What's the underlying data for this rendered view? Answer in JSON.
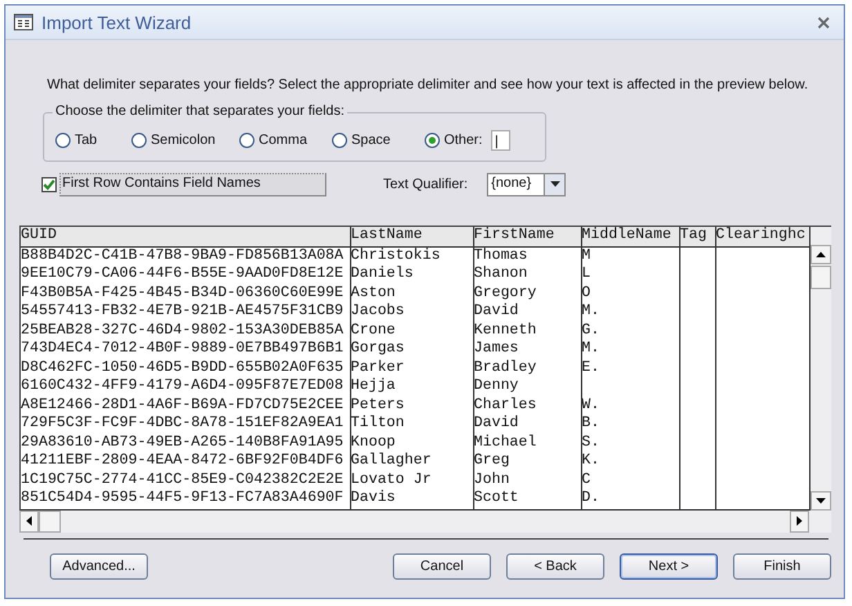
{
  "window": {
    "title": "Import Text Wizard"
  },
  "prompt": "What delimiter separates your fields? Select the appropriate delimiter and see how your text is affected in the preview below.",
  "delimiter_group": {
    "legend": "Choose the delimiter that separates your fields:",
    "options": [
      {
        "label": "Tab",
        "selected": false
      },
      {
        "label": "Semicolon",
        "selected": false
      },
      {
        "label": "Comma",
        "selected": false
      },
      {
        "label": "Space",
        "selected": false
      },
      {
        "label": "Other:",
        "selected": true
      }
    ],
    "other_value": "|"
  },
  "first_row_names": {
    "label": "First Row Contains Field Names",
    "checked": true
  },
  "text_qualifier": {
    "label": "Text Qualifier:",
    "value": "{none}"
  },
  "preview": {
    "columns": [
      "GUID",
      "LastName",
      "FirstName",
      "MiddleName",
      "Tag",
      "Clearinghc"
    ],
    "rows": [
      [
        "B88B4D2C-C41B-47B8-9BA9-FD856B13A08A",
        "Christokis",
        "Thomas",
        "M",
        "",
        ""
      ],
      [
        "9EE10C79-CA06-44F6-B55E-9AAD0FD8E12E",
        "Daniels",
        "Shanon",
        "L",
        "",
        ""
      ],
      [
        "F43B0B5A-F425-4B45-B34D-06360C60E99E",
        "Aston",
        "Gregory",
        "O",
        "",
        ""
      ],
      [
        "54557413-FB32-4E7B-921B-AE4575F31CB9",
        "Jacobs",
        "David",
        "M.",
        "",
        ""
      ],
      [
        "25BEAB28-327C-46D4-9802-153A30DEB85A",
        "Crone",
        "Kenneth",
        "G.",
        "",
        ""
      ],
      [
        "743D4EC4-7012-4B0F-9889-0E7BB497B6B1",
        "Gorgas",
        "James",
        "M.",
        "",
        ""
      ],
      [
        "D8C462FC-1050-46D5-B9DD-655B02A0F635",
        "Parker",
        "Bradley",
        "E.",
        "",
        ""
      ],
      [
        "6160C432-4FF9-4179-A6D4-095F87E7ED08",
        "Hejja",
        "Denny",
        "",
        "",
        ""
      ],
      [
        "A8E12466-28D1-4A6F-B69A-FD7CD75E2CEE",
        "Peters",
        "Charles",
        "W.",
        "",
        ""
      ],
      [
        "729F5C3F-FC9F-4DBC-8A78-151EF82A9EA1",
        "Tilton",
        "David",
        "B.",
        "",
        ""
      ],
      [
        "29A83610-AB73-49EB-A265-140B8FA91A95",
        "Knoop",
        "Michael",
        "S.",
        "",
        ""
      ],
      [
        "41211EBF-2809-4EAA-8472-6BF92F0B4DF6",
        "Gallagher",
        "Greg",
        "K.",
        "",
        ""
      ],
      [
        "1C19C75C-2774-41CC-85E9-C042382C2E2E",
        "Lovato Jr",
        "John",
        "C",
        "",
        ""
      ],
      [
        "851C54D4-9595-44F5-9F13-FC7A83A4690F",
        "Davis",
        "Scott",
        "D.",
        "",
        ""
      ]
    ]
  },
  "buttons": [
    {
      "label": "Advanced...",
      "default": false
    },
    {
      "label": "Cancel",
      "default": false
    },
    {
      "label": "< Back",
      "default": false
    },
    {
      "label": "Next >",
      "default": true
    },
    {
      "label": "Finish",
      "default": false
    }
  ]
}
